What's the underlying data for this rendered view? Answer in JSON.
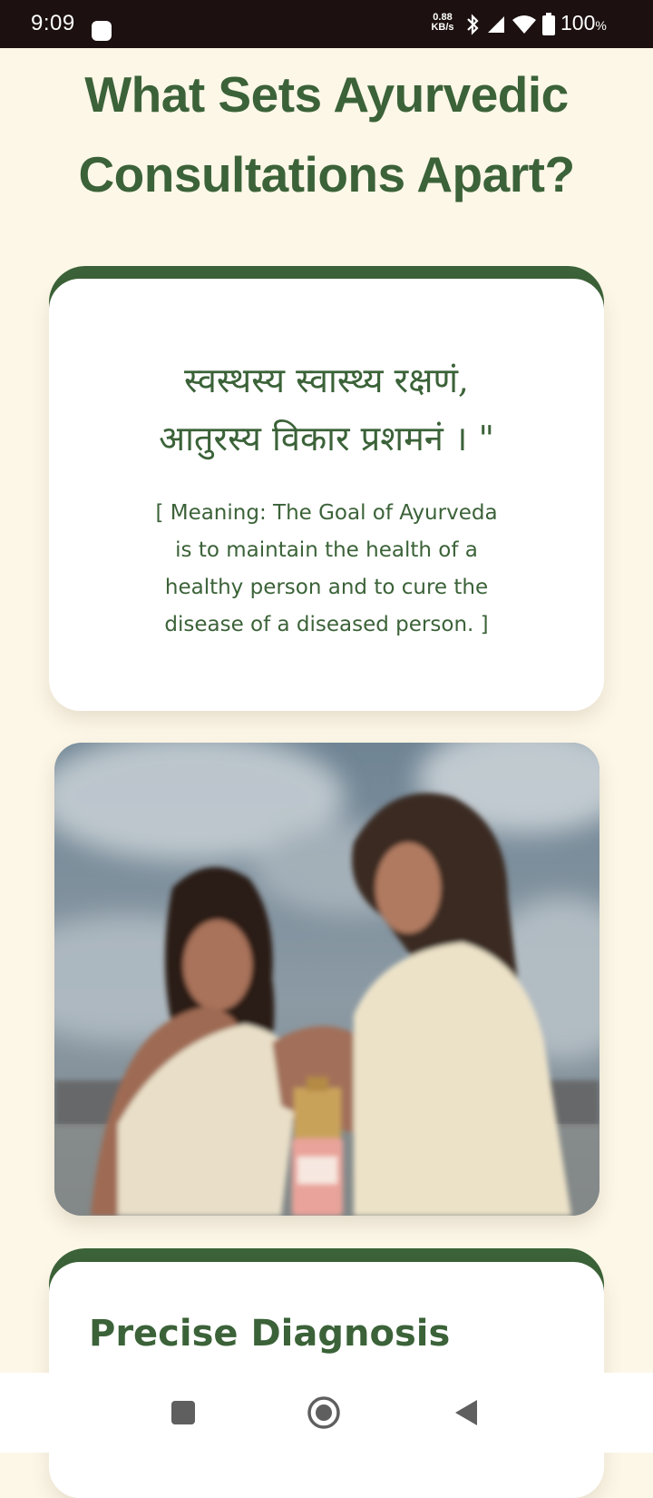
{
  "status_bar": {
    "time": "9:09",
    "net_speed_value": "0.88",
    "net_speed_unit": "KB/s",
    "battery_value": "100",
    "battery_unit": "%"
  },
  "page": {
    "title_line1": "What Sets Ayurvedic",
    "title_line2": "Consultations Apart?"
  },
  "quote_card": {
    "sanskrit_line1": "स्वस्थस्य स्वास्थ्य रक्षणं,",
    "sanskrit_line2": "आतुरस्य विकार प्रशमनं । \"",
    "meaning_line1": "[ Meaning: The Goal of Ayurveda",
    "meaning_line2": "is to maintain the health of a",
    "meaning_line3": "healthy person and to cure the",
    "meaning_line4": "disease of a diseased person. ]"
  },
  "diagnosis_card": {
    "title": "Precise Diagnosis"
  },
  "colors": {
    "brand_green": "#3b6238",
    "page_background": "#fdf7e8",
    "status_bar_background": "#1c1110"
  },
  "icons": {
    "status": [
      "bluetooth-icon",
      "signal-icon",
      "wifi-icon",
      "battery-icon"
    ],
    "nav": [
      "recents-square-icon",
      "home-circle-icon",
      "back-triangle-icon"
    ]
  }
}
